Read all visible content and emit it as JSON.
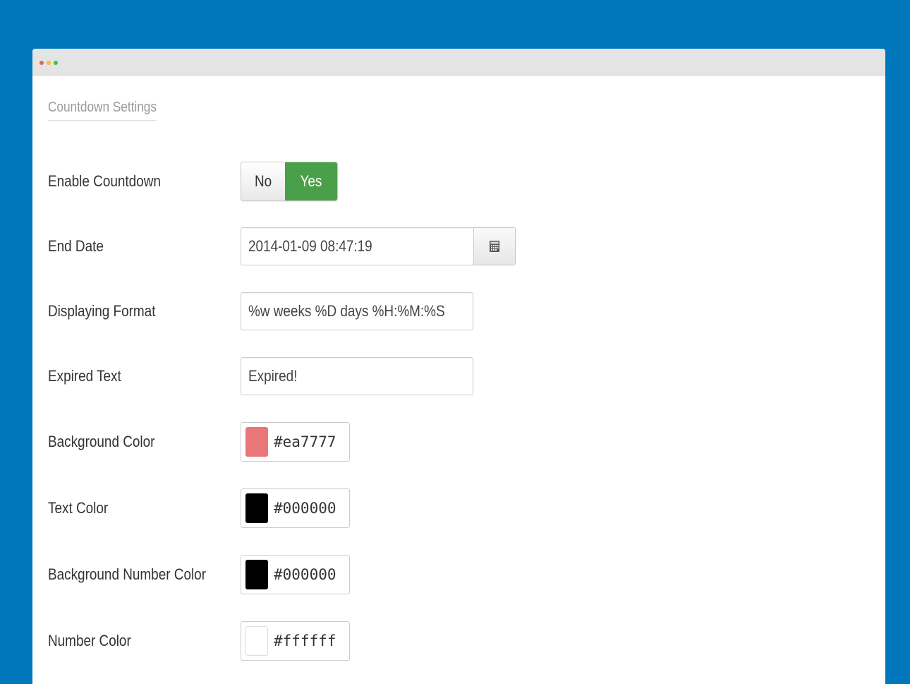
{
  "section_title": "Countdown Settings",
  "fields": {
    "enable": {
      "label": "Enable Countdown",
      "options": {
        "no": "No",
        "yes": "Yes"
      },
      "selected": "Yes"
    },
    "end_date": {
      "label": "End Date",
      "value": "2014-01-09 08:47:19",
      "icon": "calendar-icon"
    },
    "format": {
      "label": "Displaying Format",
      "value": "%w weeks %D days %H:%M:%S"
    },
    "expired": {
      "label": "Expired Text",
      "value": "Expired!"
    },
    "bg_color": {
      "label": "Background Color",
      "value": "#ea7777"
    },
    "text_color": {
      "label": "Text Color",
      "value": "#000000"
    },
    "bg_number_color": {
      "label": "Background Number Color",
      "value": "#000000"
    },
    "number_color": {
      "label": "Number Color",
      "value": "#ffffff"
    }
  },
  "colors": {
    "page_background": "#0076bb",
    "toggle_active": "#4aa04a"
  }
}
